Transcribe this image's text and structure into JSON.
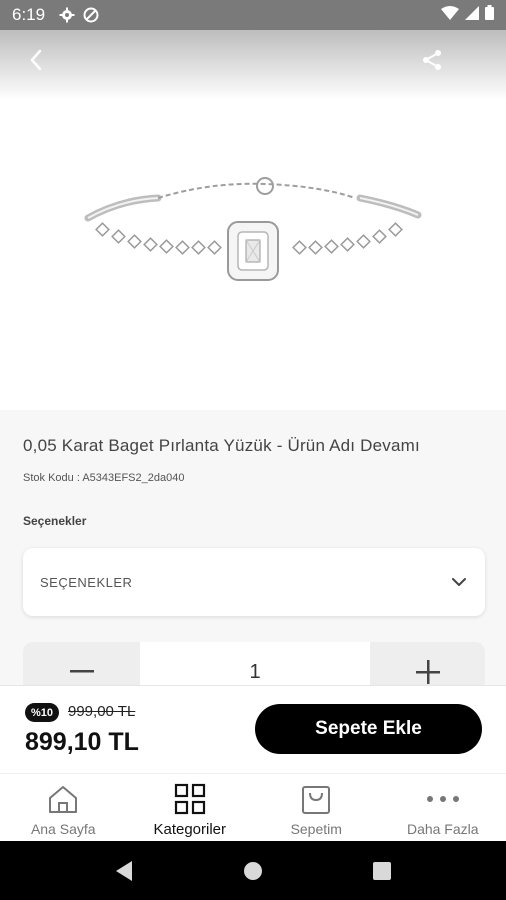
{
  "status_bar": {
    "time": "6:19"
  },
  "product": {
    "title": "0,05 Karat Baget Pırlanta Yüzük - Ürün Adı Devamı",
    "sku": "Stok Kodu : A5343EFS2_2da040",
    "image_icon": "bracelet-image"
  },
  "options": {
    "label": "Seçenekler",
    "selected": "SEÇENEKLER"
  },
  "quantity": {
    "value": "1"
  },
  "price": {
    "discount_badge": "%10",
    "old_price": "999,00 TL",
    "new_price": "899,10 TL",
    "add_to_cart": "Sepete Ekle"
  },
  "tabs": [
    {
      "label": "Ana Sayfa",
      "icon": "home-icon",
      "active": false
    },
    {
      "label": "Kategoriler",
      "icon": "grid-icon",
      "active": true
    },
    {
      "label": "Sepetim",
      "icon": "bag-icon",
      "active": false
    },
    {
      "label": "Daha Fazla",
      "icon": "more-icon",
      "active": false
    }
  ],
  "colors": {
    "accent": "#000000",
    "details_bg": "#f7f7f7",
    "status_bar": "#7a7a7a"
  }
}
